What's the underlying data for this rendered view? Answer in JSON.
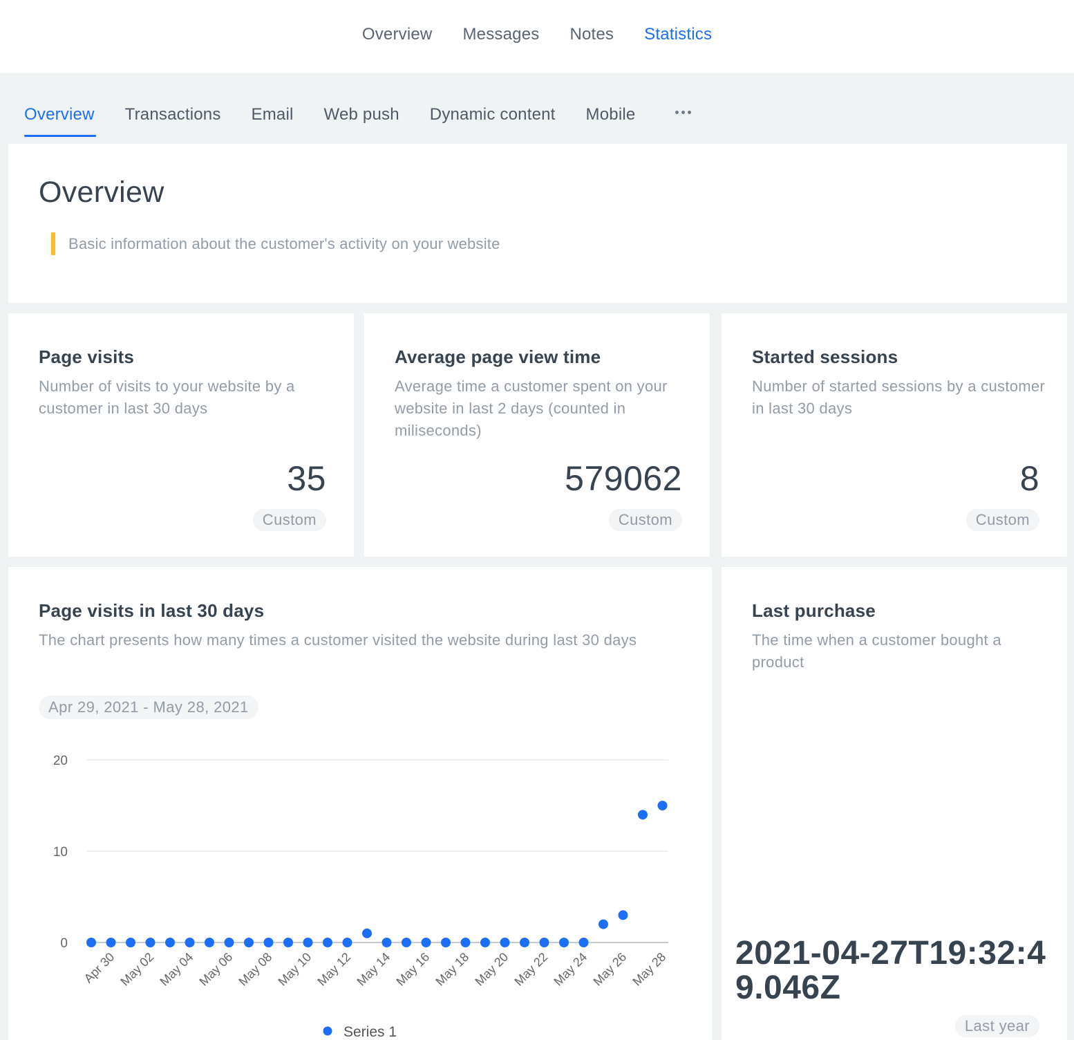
{
  "top_nav": {
    "items": [
      {
        "label": "Overview",
        "active": false
      },
      {
        "label": "Messages",
        "active": false
      },
      {
        "label": "Notes",
        "active": false
      },
      {
        "label": "Statistics",
        "active": true
      }
    ]
  },
  "sub_tabs": {
    "items": [
      {
        "label": "Overview",
        "active": true
      },
      {
        "label": "Transactions",
        "active": false
      },
      {
        "label": "Email",
        "active": false
      },
      {
        "label": "Web push",
        "active": false
      },
      {
        "label": "Dynamic content",
        "active": false
      },
      {
        "label": "Mobile",
        "active": false
      }
    ],
    "more_icon": "more-horizontal-icon"
  },
  "overview": {
    "title": "Overview",
    "hint": "Basic information about the customer's activity on your website"
  },
  "stats": [
    {
      "title": "Page visits",
      "description": "Number of visits to your website by a customer in last 30 days",
      "value": "35",
      "period": "Custom"
    },
    {
      "title": "Average page view time",
      "description": "Average time a customer spent on your website in last 2 days (counted in miliseconds)",
      "value": "579062",
      "period": "Custom"
    },
    {
      "title": "Started sessions",
      "description": "Number of started sessions by a customer in last 30 days",
      "value": "8",
      "period": "Custom"
    }
  ],
  "page_visits_chart": {
    "title": "Page visits in last 30 days",
    "description": "The chart presents how many times a customer visited the website during last 30 days",
    "date_range": "Apr 29, 2021 - May 28, 2021"
  },
  "last_purchase": {
    "title": "Last purchase",
    "description": "The time when a customer bought a product",
    "value": "2021-04-27T19:32:49.046Z",
    "period": "Last year"
  },
  "colors": {
    "accent": "#1c6ef5",
    "hint_bar": "#fbbd2d",
    "text_dark": "#384350",
    "text_muted": "#939ca6",
    "background": "#f0f3f4"
  },
  "chart_data": {
    "type": "scatter",
    "title": "Page visits in last 30 days",
    "xlabel": "",
    "ylabel": "",
    "x": [
      "Apr 29",
      "Apr 30",
      "May 01",
      "May 02",
      "May 03",
      "May 04",
      "May 05",
      "May 06",
      "May 07",
      "May 08",
      "May 09",
      "May 10",
      "May 11",
      "May 12",
      "May 13",
      "May 14",
      "May 15",
      "May 16",
      "May 17",
      "May 18",
      "May 19",
      "May 20",
      "May 21",
      "May 22",
      "May 23",
      "May 24",
      "May 25",
      "May 26",
      "May 27",
      "May 28"
    ],
    "x_tick_labels": [
      "Apr 30",
      "May 02",
      "May 04",
      "May 06",
      "May 08",
      "May 10",
      "May 12",
      "May 14",
      "May 16",
      "May 18",
      "May 20",
      "May 22",
      "May 24",
      "May 26",
      "May 28"
    ],
    "series": [
      {
        "name": "Series 1",
        "color": "#1c6ef5",
        "values": [
          0,
          0,
          0,
          0,
          0,
          0,
          0,
          0,
          0,
          0,
          0,
          0,
          0,
          0,
          1,
          0,
          0,
          0,
          0,
          0,
          0,
          0,
          0,
          0,
          0,
          0,
          2,
          3,
          14,
          15
        ]
      }
    ],
    "y_ticks": [
      0,
      10,
      20
    ],
    "ylim": [
      0,
      20
    ],
    "grid": true,
    "legend": "bottom-center"
  }
}
